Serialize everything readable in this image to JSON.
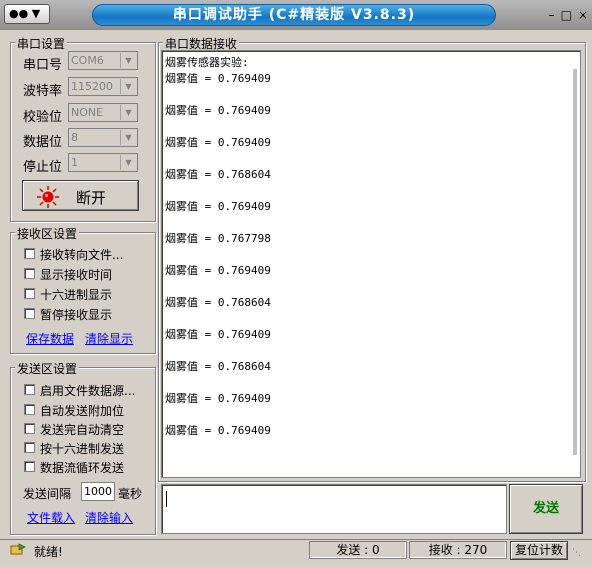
{
  "window": {
    "title": "串口调试助手 (C#精装版 V3.8.3)",
    "sysmenu_label": "▼",
    "controls": [
      "–",
      "□",
      "×"
    ]
  },
  "serial_settings": {
    "group_title": "串口设置",
    "port_label": "串口号",
    "port_value": "COM6",
    "baud_label": "波特率",
    "baud_value": "115200",
    "parity_label": "校验位",
    "parity_value": "NONE",
    "databits_label": "数据位",
    "databits_value": "8",
    "stopbits_label": "停止位",
    "stopbits_value": "1",
    "connect_button": "断开"
  },
  "receive_settings": {
    "group_title": "接收区设置",
    "options": [
      "接收转向文件...",
      "显示接收时间",
      "十六进制显示",
      "暂停接收显示"
    ],
    "save_link": "保存数据",
    "clear_link": "清除显示"
  },
  "send_settings": {
    "group_title": "发送区设置",
    "options": [
      "启用文件数据源...",
      "自动发送附加位",
      "发送完自动清空",
      "按十六进制发送",
      "数据流循环发送"
    ],
    "interval_label": "发送间隔",
    "interval_value": "1000",
    "interval_unit": "毫秒",
    "load_file_link": "文件载入",
    "clear_input_link": "清除输入"
  },
  "receive_area": {
    "group_title": "串口数据接收",
    "lines": [
      "烟雾传感器实验:",
      "烟雾值 = 0.769409",
      "烟雾值 = 0.769409",
      "烟雾值 = 0.769409",
      "烟雾值 = 0.768604",
      "烟雾值 = 0.769409",
      "烟雾值 = 0.767798",
      "烟雾值 = 0.769409",
      "烟雾值 = 0.768604",
      "烟雾值 = 0.769409",
      "烟雾值 = 0.768604",
      "烟雾值 = 0.769409",
      "烟雾值 = 0.769409"
    ]
  },
  "send_area": {
    "value": "",
    "send_button": "发送"
  },
  "status_bar": {
    "ready": "就绪!",
    "sent": "发送 : 0",
    "received": "接收 : 270",
    "reset_button": "复位计数"
  }
}
